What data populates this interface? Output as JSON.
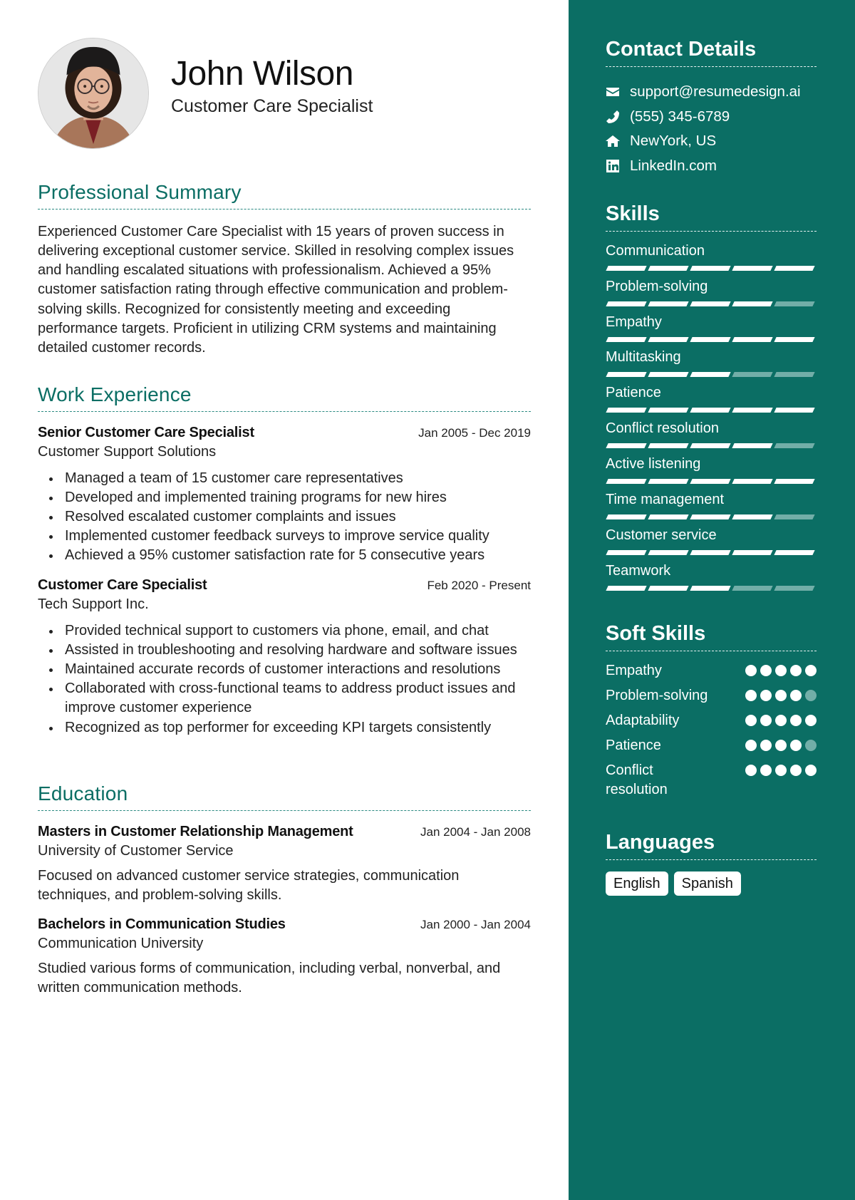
{
  "header": {
    "name": "John Wilson",
    "title": "Customer Care Specialist",
    "photo": "profile-photo"
  },
  "summary": {
    "heading": "Professional Summary",
    "text": "Experienced Customer Care Specialist with 15 years of proven success in delivering exceptional customer service. Skilled in resolving complex issues and handling escalated situations with professionalism. Achieved a 95% customer satisfaction rating through effective communication and problem-solving skills. Recognized for consistently meeting and exceeding performance targets. Proficient in utilizing CRM systems and maintaining detailed customer records."
  },
  "work": {
    "heading": "Work Experience",
    "jobs": [
      {
        "role": "Senior Customer Care Specialist",
        "date": "Jan 2005 - Dec 2019",
        "org": "Customer Support Solutions",
        "bullets": [
          "Managed a team of 15 customer care representatives",
          "Developed and implemented training programs for new hires",
          "Resolved escalated customer complaints and issues",
          "Implemented customer feedback surveys to improve service quality",
          "Achieved a 95% customer satisfaction rate for 5 consecutive years"
        ]
      },
      {
        "role": "Customer Care Specialist",
        "date": "Feb 2020 - Present",
        "org": "Tech Support Inc.",
        "bullets": [
          "Provided technical support to customers via phone, email, and chat",
          "Assisted in troubleshooting and resolving hardware and software issues",
          "Maintained accurate records of customer interactions and resolutions",
          "Collaborated with cross-functional teams to address product issues and improve customer experience",
          "Recognized as top performer for exceeding KPI targets consistently"
        ]
      }
    ]
  },
  "education": {
    "heading": "Education",
    "items": [
      {
        "degree": "Masters in Customer Relationship Management",
        "date": "Jan 2004 - Jan 2008",
        "school": "University of Customer Service",
        "desc": "Focused on advanced customer service strategies, communication techniques, and problem-solving skills."
      },
      {
        "degree": "Bachelors in Communication Studies",
        "date": "Jan 2000 - Jan 2004",
        "school": "Communication University",
        "desc": "Studied various forms of communication, including verbal, nonverbal, and written communication methods."
      }
    ]
  },
  "sidebar": {
    "contact": {
      "heading": "Contact Details",
      "items": [
        {
          "icon": "envelope-icon",
          "text": "support@resumedesign.ai"
        },
        {
          "icon": "phone-icon",
          "text": "(555) 345-6789"
        },
        {
          "icon": "home-icon",
          "text": "NewYork, US"
        },
        {
          "icon": "linkedin-icon",
          "text": "LinkedIn.com"
        }
      ]
    },
    "skills": {
      "heading": "Skills",
      "max": 5,
      "items": [
        {
          "name": "Communication",
          "level": 5
        },
        {
          "name": "Problem-solving",
          "level": 4
        },
        {
          "name": "Empathy",
          "level": 5
        },
        {
          "name": "Multitasking",
          "level": 3
        },
        {
          "name": "Patience",
          "level": 5
        },
        {
          "name": "Conflict resolution",
          "level": 4
        },
        {
          "name": "Active listening",
          "level": 5
        },
        {
          "name": "Time management",
          "level": 4
        },
        {
          "name": "Customer service",
          "level": 5
        },
        {
          "name": "Teamwork",
          "level": 3
        }
      ]
    },
    "soft_skills": {
      "heading": "Soft Skills",
      "max": 5,
      "items": [
        {
          "name": "Empathy",
          "level": 5
        },
        {
          "name": "Problem-solving",
          "level": 4
        },
        {
          "name": "Adaptability",
          "level": 5
        },
        {
          "name": "Patience",
          "level": 4
        },
        {
          "name": "Conflict resolution",
          "level": 5
        }
      ]
    },
    "languages": {
      "heading": "Languages",
      "items": [
        "English",
        "Spanish"
      ]
    }
  },
  "colors": {
    "accent": "#0b6e64",
    "sidebar_bg": "#0b6e64",
    "inactive": "#72aea8",
    "text": "#222222"
  }
}
